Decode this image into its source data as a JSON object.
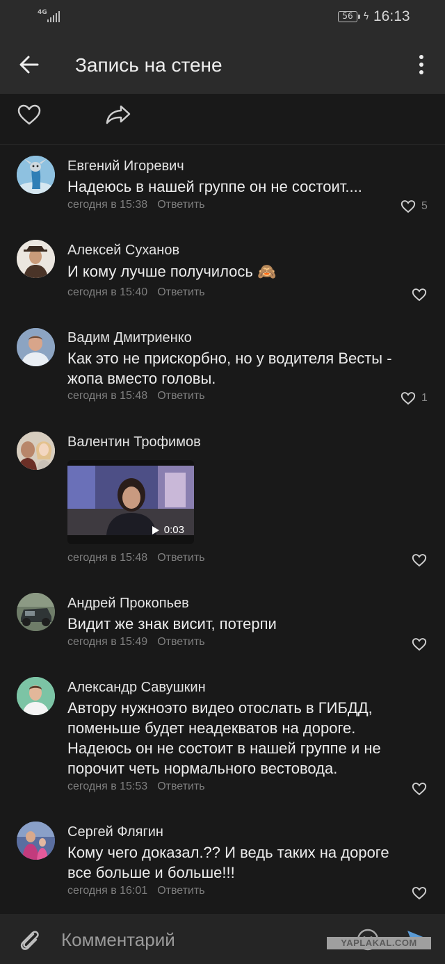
{
  "status_bar": {
    "network": "4G",
    "battery": "56",
    "time": "16:13"
  },
  "header": {
    "title": "Запись на стене"
  },
  "comments": [
    {
      "author": "Евгений Игоревич",
      "text": "Надеюсь в нашей группе он не состоит....",
      "time": "сегодня в 15:38",
      "reply": "Ответить",
      "likes": "5"
    },
    {
      "author": "Алексей Суханов",
      "text": "И кому лучше получилось 🙈",
      "time": "сегодня в 15:40",
      "reply": "Ответить",
      "likes": ""
    },
    {
      "author": "Вадим Дмитриенко",
      "text": "Как это не прискорбно, но у водителя Весты - жопа вместо головы.",
      "time": "сегодня в 15:48",
      "reply": "Ответить",
      "likes": "1"
    },
    {
      "author": "Валентин Трофимов",
      "text": "",
      "video_duration": "0:03",
      "time": "сегодня в 15:48",
      "reply": "Ответить",
      "likes": ""
    },
    {
      "author": "Андрей Прокопьев",
      "text": "Видит же знак висит, потерпи",
      "time": "сегодня в 15:49",
      "reply": "Ответить",
      "likes": ""
    },
    {
      "author": "Александр Савушкин",
      "text": "Автору нужноэто видео отослать в ГИБДД, поменьше будет неадекватов на дороге. Надеюсь он не состоит в нашей группе и не порочит четь нормального вестовода.",
      "time": "сегодня в 15:53",
      "reply": "Ответить",
      "likes": ""
    },
    {
      "author": "Сергей Флягин",
      "text": "Кому чего доказал.?? И ведь таких на дороге все больше и больше!!!",
      "time": "сегодня в 16:01",
      "reply": "Ответить",
      "likes": ""
    }
  ],
  "composer": {
    "placeholder": "Комментарий",
    "watermark": "YAPLAKAL.COM"
  },
  "colors": {
    "background": "#191919",
    "header": "#2b2b2b",
    "accent": "#5b9bd5"
  }
}
